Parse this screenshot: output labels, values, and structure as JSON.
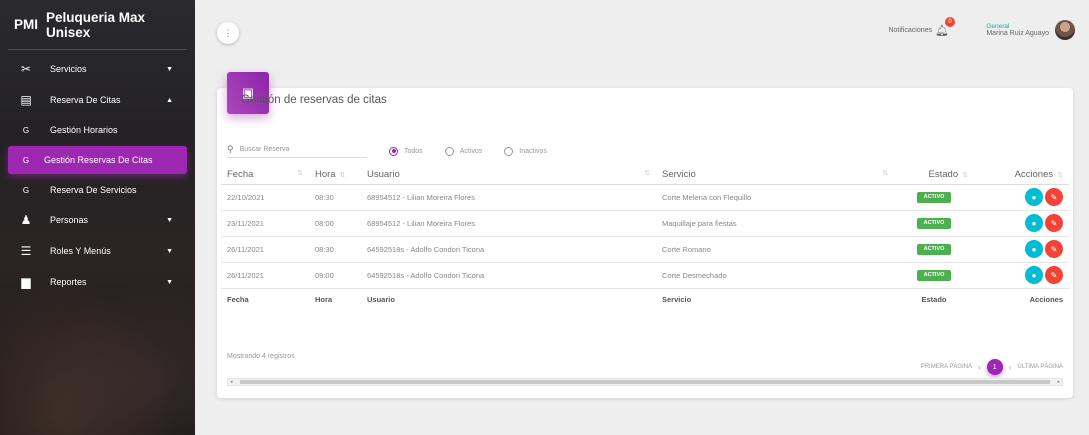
{
  "sidebar": {
    "brand_short": "PMI",
    "brand_name": "Peluqueria Max Unisex",
    "items": [
      {
        "icon": "scissors-icon",
        "label": "Servicios"
      },
      {
        "icon": "calendar-icon",
        "label": "Reserva De Citas"
      },
      {
        "icon": "sub-g-icon",
        "label": "Gestión Horarios"
      },
      {
        "icon": "sub-g-icon",
        "label": "Gestión Reservas De Citas"
      },
      {
        "icon": "sub-g-icon",
        "label": "Reserva De Servicios"
      },
      {
        "icon": "person-icon",
        "label": "Personas"
      },
      {
        "icon": "list-icon",
        "label": "Roles Y Menús"
      },
      {
        "icon": "document-icon",
        "label": "Reportes"
      }
    ],
    "sub_icon_letter": "G"
  },
  "topbar": {
    "notifications_label": "Notificaciones",
    "notifications_count": "0",
    "user_role": "General",
    "user_name": "Marina Ruiz Aguayo"
  },
  "card": {
    "title": "Gestión de reservas de citas",
    "search_placeholder": "Buscar Reserva",
    "filters": [
      "Todos",
      "Activos",
      "Inactivos"
    ],
    "columns": [
      "Fecha",
      "Hora",
      "Usuario",
      "Servicio",
      "Estado",
      "Acciones"
    ],
    "rows": [
      {
        "fecha": "22/10/2021",
        "hora": "08:30",
        "usuario": "68954512 - Lilian Moreira Flores",
        "servicio": "Corte Melena con Flequillo",
        "estado": "ACTIVO"
      },
      {
        "fecha": "23/11/2021",
        "hora": "08:00",
        "usuario": "68954512 - Lilian Moreira Flores",
        "servicio": "Maquillaje para fiestas",
        "estado": "ACTIVO"
      },
      {
        "fecha": "26/11/2021",
        "hora": "08:30",
        "usuario": "64592518s - Adolfo Condori Ticona",
        "servicio": "Corte Romano",
        "estado": "ACTIVO"
      },
      {
        "fecha": "26/11/2021",
        "hora": "09:00",
        "usuario": "64592518s - Adolfo Condori Ticona",
        "servicio": "Corte Desmechado",
        "estado": "ACTIVO"
      }
    ],
    "info": "Mostrando 4 registros",
    "pager": {
      "first": "PRIMERA PÁGINA",
      "current": "1",
      "last": "ÚLTIMA PÁGINA"
    }
  },
  "colors": {
    "accent": "#9c27b0",
    "active_badge": "#4caf50",
    "view_button": "#00bcd4",
    "delete_button": "#f44336"
  }
}
